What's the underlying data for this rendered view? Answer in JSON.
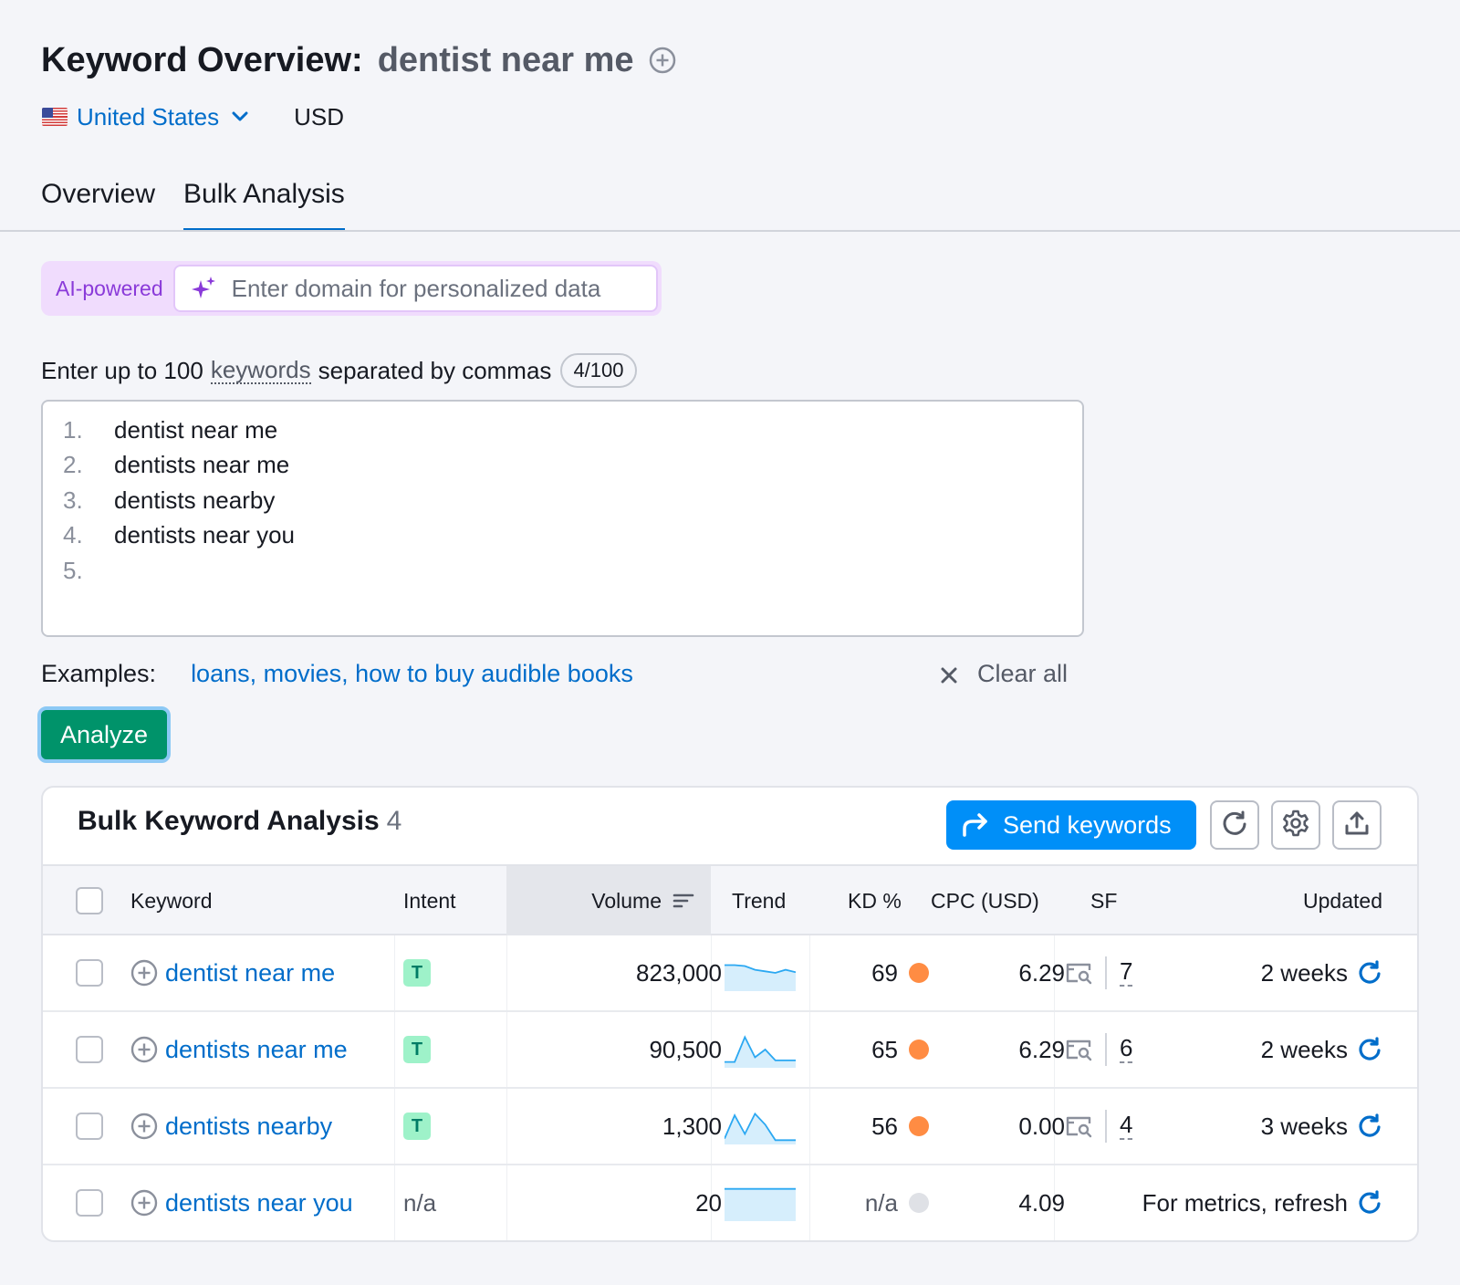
{
  "header": {
    "title": "Keyword Overview:",
    "keyword": "dentist near me",
    "country": "United States",
    "currency": "USD"
  },
  "tabs": [
    {
      "label": "Overview",
      "active": false
    },
    {
      "label": "Bulk Analysis",
      "active": true
    }
  ],
  "ai": {
    "label": "AI-powered",
    "placeholder": "Enter domain for personalized data"
  },
  "keyword_input": {
    "label_prefix": "Enter up to 100",
    "label_link": "keywords",
    "label_suffix": "separated by commas",
    "counter": "4/100",
    "lines": [
      {
        "num": "1.",
        "text": "dentist near me"
      },
      {
        "num": "2.",
        "text": "dentists near me"
      },
      {
        "num": "3.",
        "text": "dentists nearby"
      },
      {
        "num": "4.",
        "text": "dentists near you"
      },
      {
        "num": "5.",
        "text": ""
      }
    ]
  },
  "examples": {
    "label": "Examples:",
    "link": "loans, movies, how to buy audible books",
    "clear_all": "Clear all"
  },
  "analyze_label": "Analyze",
  "results": {
    "title": "Bulk Keyword Analysis",
    "count": "4",
    "send_label": "Send keywords",
    "columns": {
      "keyword": "Keyword",
      "intent": "Intent",
      "volume": "Volume",
      "trend": "Trend",
      "kd": "KD %",
      "cpc": "CPC (USD)",
      "sf": "SF",
      "updated": "Updated"
    },
    "rows": [
      {
        "keyword": "dentist near me",
        "intent": "T",
        "volume": "823,000",
        "kd": "69",
        "kd_color": "#ff8c43",
        "cpc": "6.29",
        "sf": "7",
        "updated": "2 weeks",
        "trend": [
          0.75,
          0.75,
          0.72,
          0.6,
          0.55,
          0.5,
          0.6,
          0.52
        ]
      },
      {
        "keyword": "dentists near me",
        "intent": "T",
        "volume": "90,500",
        "kd": "65",
        "kd_color": "#ff8c43",
        "cpc": "6.29",
        "sf": "6",
        "updated": "2 weeks",
        "trend": [
          0.1,
          0.1,
          0.9,
          0.25,
          0.5,
          0.15,
          0.15,
          0.15
        ]
      },
      {
        "keyword": "dentists nearby",
        "intent": "T",
        "volume": "1,300",
        "kd": "56",
        "kd_color": "#ff8c43",
        "cpc": "0.00",
        "sf": "4",
        "updated": "3 weeks",
        "trend": [
          0.1,
          0.85,
          0.25,
          0.9,
          0.55,
          0.05,
          0.05,
          0.05
        ]
      },
      {
        "keyword": "dentists near you",
        "intent": "n/a",
        "volume": "20",
        "kd": "n/a",
        "kd_color": "#dfe1e6",
        "cpc": "4.09",
        "sf": "",
        "updated": "For metrics, refresh",
        "trend": [
          0.95,
          0.95,
          0.95,
          0.95,
          0.95,
          0.95,
          0.95,
          0.95
        ]
      }
    ]
  },
  "colors": {
    "accent": "#006dca",
    "primary_button": "#008ff8",
    "analyze_button": "#00936a",
    "ai_purple": "#8a3ad9"
  },
  "icons": [
    "add-keyword-icon",
    "us-flag-icon",
    "chevron-down-icon",
    "sparkle-icon",
    "close-icon",
    "share-arrow-icon",
    "refresh-icon",
    "gear-icon",
    "export-icon",
    "serp-features-icon"
  ]
}
